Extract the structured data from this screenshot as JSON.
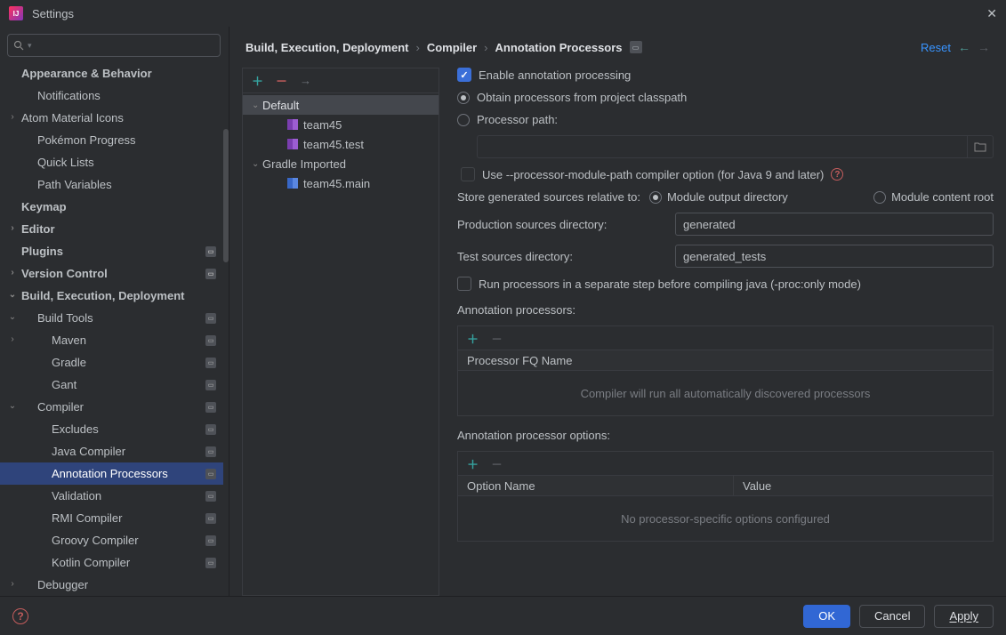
{
  "window": {
    "title": "Settings"
  },
  "search": {
    "placeholder": ""
  },
  "sidebar": {
    "items": [
      {
        "label": "Appearance & Behavior",
        "bold": true,
        "level": 0,
        "chev": ""
      },
      {
        "label": "Notifications",
        "level": 1
      },
      {
        "label": "Atom Material Icons",
        "level": 0,
        "chev": "›"
      },
      {
        "label": "Pokémon Progress",
        "level": 1
      },
      {
        "label": "Quick Lists",
        "level": 1
      },
      {
        "label": "Path Variables",
        "level": 1
      },
      {
        "label": "Keymap",
        "bold": true,
        "level": 0
      },
      {
        "label": "Editor",
        "bold": true,
        "level": 0,
        "chev": "›"
      },
      {
        "label": "Plugins",
        "bold": true,
        "level": 0,
        "proj": true
      },
      {
        "label": "Version Control",
        "bold": true,
        "level": 0,
        "chev": "›",
        "proj": true
      },
      {
        "label": "Build, Execution, Deployment",
        "bold": true,
        "level": 0,
        "chev": "⌄"
      },
      {
        "label": "Build Tools",
        "level": 1,
        "chev": "⌄",
        "proj": true
      },
      {
        "label": "Maven",
        "level": 2,
        "chev": "›",
        "proj": true
      },
      {
        "label": "Gradle",
        "level": 2,
        "proj": true
      },
      {
        "label": "Gant",
        "level": 2,
        "proj": true
      },
      {
        "label": "Compiler",
        "level": 1,
        "chev": "⌄",
        "proj": true
      },
      {
        "label": "Excludes",
        "level": 2,
        "proj": true
      },
      {
        "label": "Java Compiler",
        "level": 2,
        "proj": true
      },
      {
        "label": "Annotation Processors",
        "level": 2,
        "proj": true,
        "selected": true
      },
      {
        "label": "Validation",
        "level": 2,
        "proj": true
      },
      {
        "label": "RMI Compiler",
        "level": 2,
        "proj": true
      },
      {
        "label": "Groovy Compiler",
        "level": 2,
        "proj": true
      },
      {
        "label": "Kotlin Compiler",
        "level": 2,
        "proj": true
      },
      {
        "label": "Debugger",
        "level": 1,
        "chev": "›"
      }
    ]
  },
  "breadcrumb": {
    "a": "Build, Execution, Deployment",
    "b": "Compiler",
    "c": "Annotation Processors",
    "reset": "Reset"
  },
  "profiles": [
    {
      "label": "Default",
      "chev": "⌄",
      "selected": true
    },
    {
      "label": "team45",
      "level": 1,
      "icon": "m1"
    },
    {
      "label": "team45.test",
      "level": 1,
      "icon": "m1"
    },
    {
      "label": "Gradle Imported",
      "chev": "⌄"
    },
    {
      "label": "team45.main",
      "level": 1,
      "icon": "m2"
    }
  ],
  "form": {
    "enable": "Enable annotation processing",
    "obtain": "Obtain processors from project classpath",
    "procpath": "Processor path:",
    "modulePathOpt": "Use --processor-module-path compiler option (for Java 9 and later)",
    "storeLabel": "Store generated sources relative to:",
    "storeOpt1": "Module output directory",
    "storeOpt2": "Module content root",
    "prodLabel": "Production sources directory:",
    "prodValue": "generated",
    "testLabel": "Test sources directory:",
    "testValue": "generated_tests",
    "separateStep": "Run processors in a separate step before compiling java (-proc:only mode)",
    "apLabel": "Annotation processors:",
    "apHeader": "Processor FQ Name",
    "apEmpty": "Compiler will run all automatically discovered processors",
    "optLabel": "Annotation processor options:",
    "optCol1": "Option Name",
    "optCol2": "Value",
    "optEmpty": "No processor-specific options configured"
  },
  "footer": {
    "ok": "OK",
    "cancel": "Cancel",
    "apply": "Apply"
  }
}
